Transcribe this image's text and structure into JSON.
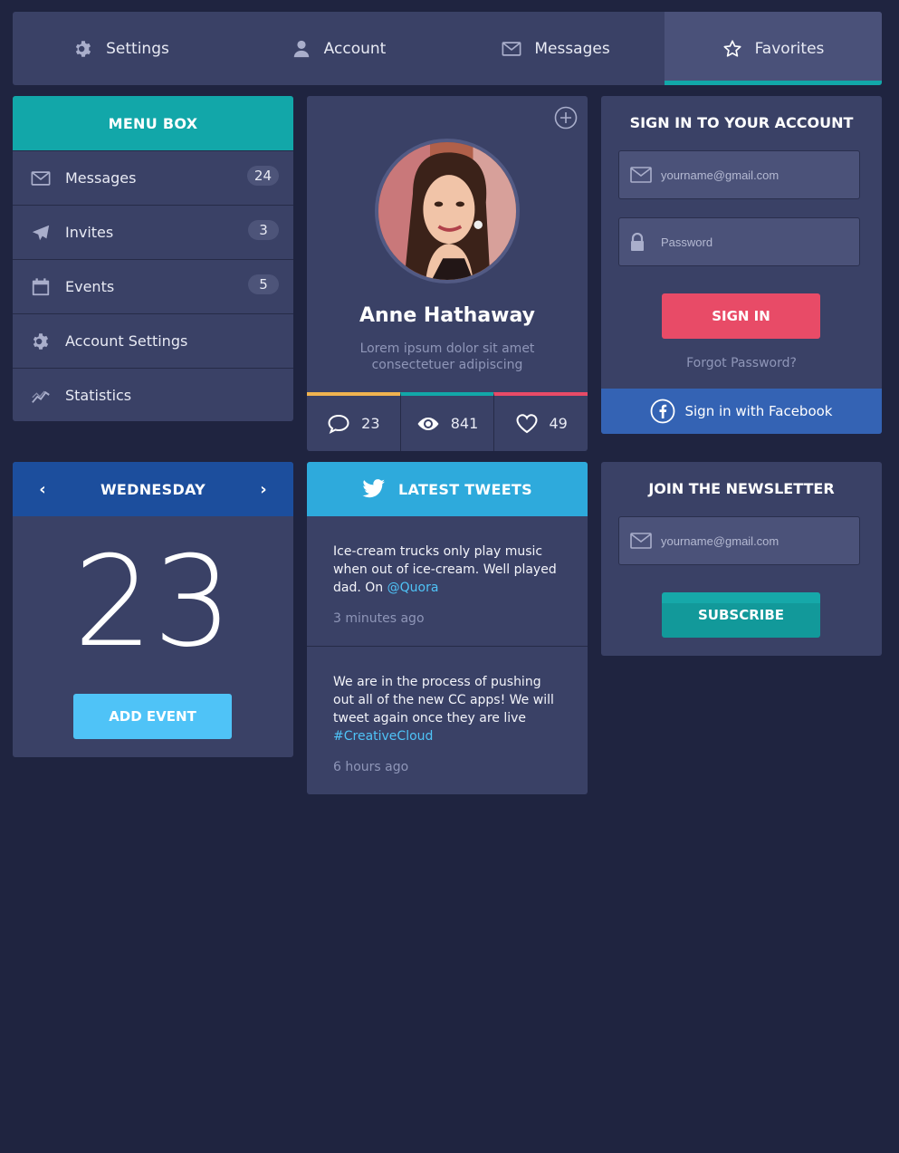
{
  "nav": {
    "tabs": [
      {
        "label": "Settings",
        "icon": "gear-icon"
      },
      {
        "label": "Account",
        "icon": "user-icon"
      },
      {
        "label": "Messages",
        "icon": "envelope-icon"
      },
      {
        "label": "Favorites",
        "icon": "star-icon",
        "active": true
      }
    ]
  },
  "menu": {
    "title": "MENU BOX",
    "items": [
      {
        "label": "Messages",
        "badge": "24",
        "icon": "envelope-icon"
      },
      {
        "label": "Invites",
        "badge": "3",
        "icon": "paper-plane-icon"
      },
      {
        "label": "Events",
        "badge": "5",
        "icon": "calendar-icon"
      },
      {
        "label": "Account Settings",
        "icon": "gear-icon"
      },
      {
        "label": "Statistics",
        "icon": "chart-line-icon"
      }
    ]
  },
  "profile": {
    "name": "Anne Hathaway",
    "bio": "Lorem ipsum dolor sit amet consectetuer adipiscing",
    "stats": [
      {
        "icon": "comment-icon",
        "value": "23",
        "color": "#f0b34f"
      },
      {
        "icon": "eye-icon",
        "value": "841",
        "color": "#12a7a9"
      },
      {
        "icon": "heart-icon",
        "value": "49",
        "color": "#e84b67"
      }
    ]
  },
  "signin": {
    "title": "SIGN IN TO YOUR ACCOUNT",
    "email_placeholder": "yourname@gmail.com",
    "password_placeholder": "Password",
    "button": "SIGN IN",
    "forgot": "Forgot Password?",
    "facebook": "Sign in with Facebook"
  },
  "calendar": {
    "day": "WEDNESDAY",
    "prev": "‹",
    "next": "›",
    "date": "23",
    "button": "ADD EVENT"
  },
  "tweets": {
    "title": "LATEST TWEETS",
    "items": [
      {
        "text": "Ice-cream trucks only play music when out of ice-cream. Well played dad. On ",
        "link": "@Quora",
        "time": "3 minutes ago"
      },
      {
        "text": "We are in the process of pushing out all of the new CC apps! We will tweet again once they are live ",
        "link": "#CreativeCloud",
        "time": "6 hours ago"
      }
    ]
  },
  "newsletter": {
    "title": "JOIN THE NEWSLETTER",
    "email_placeholder": "yourname@gmail.com",
    "button": "SUBSCRIBE"
  },
  "colors": {
    "background": "#1f2440",
    "card": "#3a4166",
    "teal": "#12a7a9",
    "red": "#e84b67",
    "blue": "#1c4e9d",
    "facebook": "#3463b4",
    "twitter": "#2eaadc",
    "sky": "#4fc3f7"
  }
}
